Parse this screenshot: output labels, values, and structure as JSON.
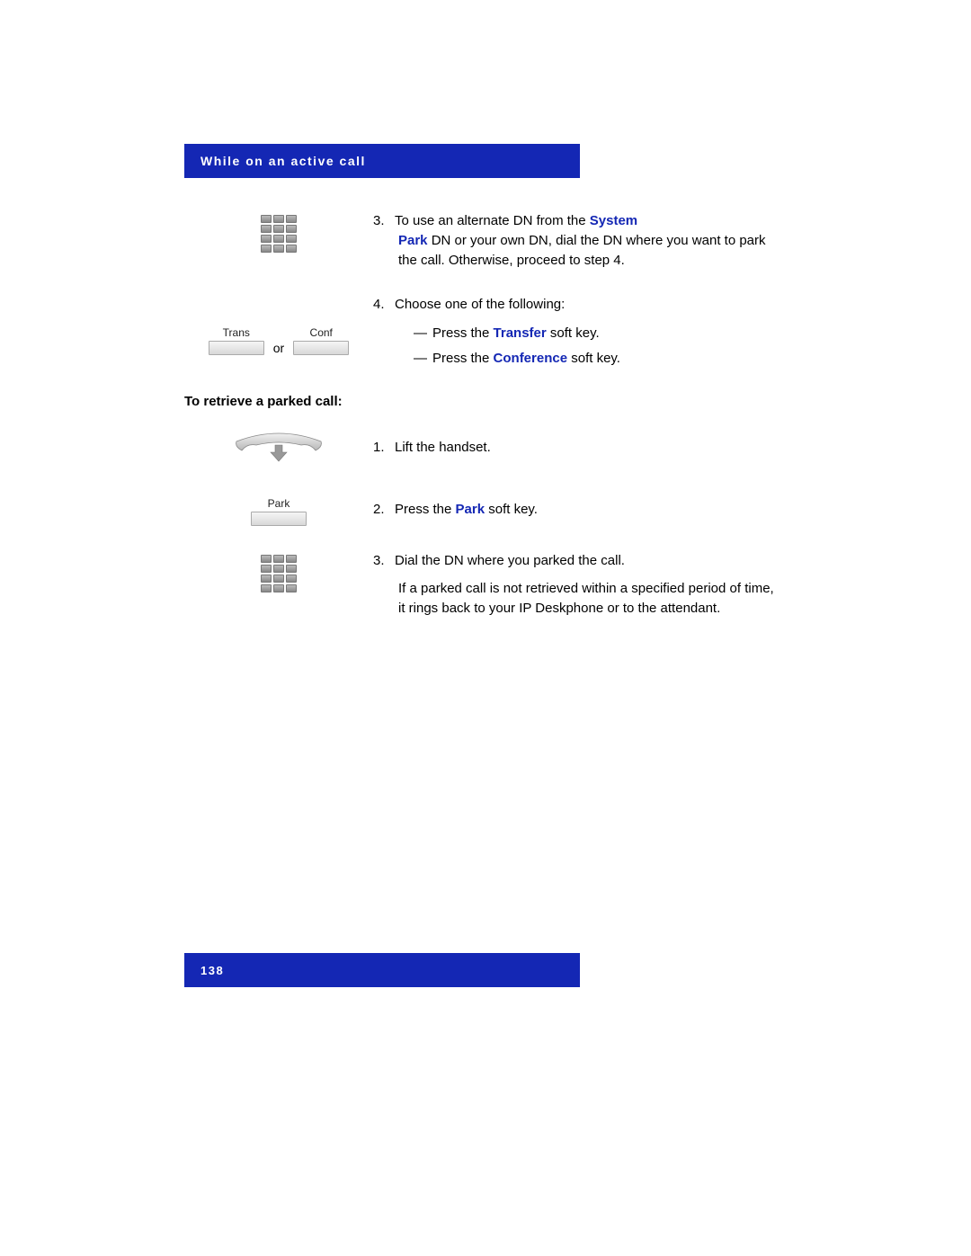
{
  "header": {
    "title": "While on an active call"
  },
  "footer": {
    "page": "138"
  },
  "step3": {
    "num": "3.",
    "prefix": "To use an alternate DN from the ",
    "boldA": "System",
    "boldB": "Park",
    "mid": " DN or your own DN, dial the DN where you want to park the call. Otherwise, proceed to step 4."
  },
  "step4": {
    "num": "4.",
    "lead": "Choose one of the following:",
    "opt1_pre": "Press the ",
    "opt1_bold": "Transfer",
    "opt1_post": " soft key.",
    "opt2_pre": "Press the ",
    "opt2_bold": "Conference",
    "opt2_post": " soft key."
  },
  "softkeys": {
    "trans": "Trans",
    "conf": "Conf",
    "or": "or",
    "park": "Park"
  },
  "retrieve_heading": "To retrieve a parked call:",
  "r1": {
    "num": "1.",
    "text": "Lift the handset."
  },
  "r2": {
    "num": "2.",
    "pre": "Press the ",
    "bold": "Park",
    "post": " soft key."
  },
  "r3": {
    "num": "3.",
    "line1": "Dial the DN where you parked the call.",
    "line2": "If a parked call is not retrieved within a specified period of time, it rings back to your IP Deskphone or to the attendant."
  }
}
